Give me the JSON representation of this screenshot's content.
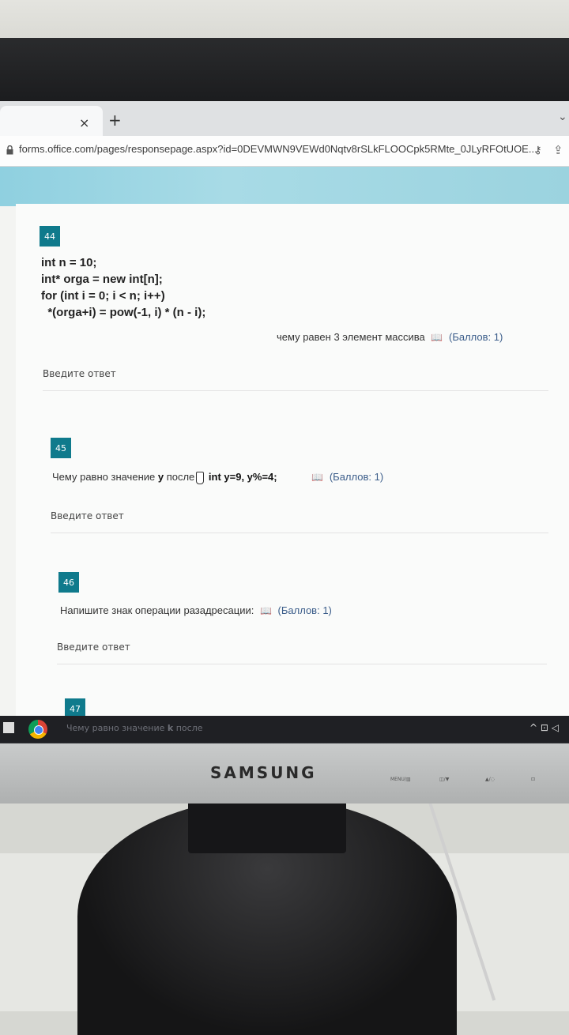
{
  "browser": {
    "new_tab_symbol": "+",
    "close_symbol": "×",
    "url": "forms.office.com/pages/responsepage.aspx?id=0DEVMWN9VEWd0Nqtv8rSLkFLOOCpk5RMte_0JLyRFOtUOE..."
  },
  "questions": [
    {
      "number": "44",
      "code_lines": [
        "int n = 10;",
        "int* orga = new int[n];",
        "for (int i = 0; i < n; i++)",
        "  *(orga+i) = pow(-1, i) * (n - i);"
      ],
      "prompt": "чему равен 3 элемент массива",
      "points": "(Баллов: 1)",
      "answer_placeholder": "Введите ответ"
    },
    {
      "number": "45",
      "prompt_start": "Чему равно значение ",
      "prompt_var": "у",
      "prompt_mid": " после",
      "prompt_code": " int y=9,  y%=4;",
      "points": "(Баллов: 1)",
      "answer_placeholder": "Введите ответ"
    },
    {
      "number": "46",
      "prompt": "Напишите знак операции разадресации:",
      "points": "(Баллов: 1)",
      "answer_placeholder": "Введите ответ"
    },
    {
      "number": "47",
      "prompt_start": "Чему равно значение ",
      "prompt_var": "k",
      "prompt_end": " после"
    }
  ],
  "monitor": {
    "brand": "SAMSUNG",
    "buttons": [
      "MENU/▥",
      "◫/▼",
      "▲/◌",
      "⊡"
    ]
  },
  "icons": {
    "lock": "lock-icon",
    "reader": "immersive-reader-icon",
    "key": "key-icon",
    "share": "share-icon",
    "chrome": "chrome-icon"
  },
  "colors": {
    "accent": "#0f7a8c",
    "banner": "#9bd3df"
  }
}
